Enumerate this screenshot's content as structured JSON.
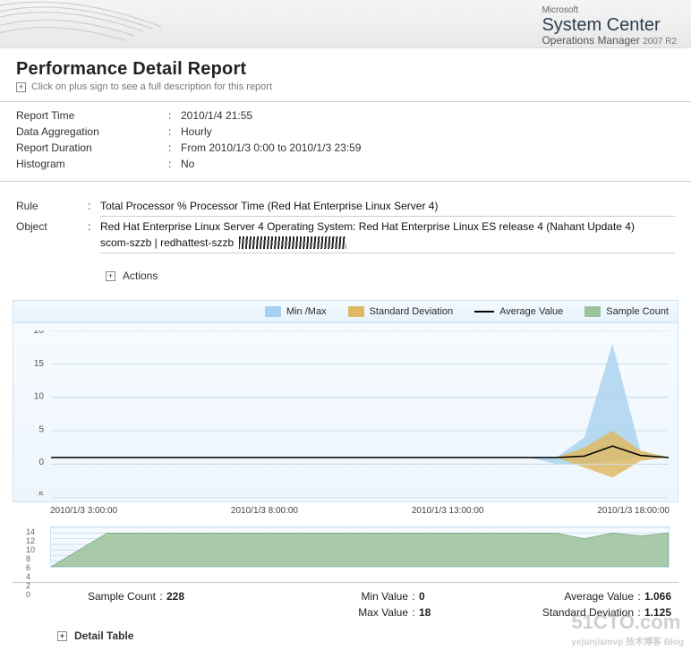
{
  "brand": {
    "ms": "Microsoft",
    "title": "System Center",
    "sub": "Operations Manager",
    "ver": "2007 R2"
  },
  "report": {
    "title": "Performance Detail Report",
    "hint": "Click on plus sign to see a full description for this report"
  },
  "meta": {
    "report_time_label": "Report Time",
    "report_time_value": "2010/1/4 21:55",
    "data_agg_label": "Data Aggregation",
    "data_agg_value": "Hourly",
    "duration_label": "Report Duration",
    "duration_value": "From  2010/1/3 0:00  to  2010/1/3 23:59",
    "histogram_label": "Histogram",
    "histogram_value": "No"
  },
  "rule": {
    "rule_label": "Rule",
    "rule_value": "Total Processor % Processor Time (Red Hat Enterprise Linux Server 4)",
    "object_label": "Object",
    "object_value_line1": "Red Hat Enterprise Linux Server 4 Operating System: Red Hat Enterprise Linux ES release 4 (Nahant Update 4)",
    "object_value_line2": "scom-szzb | redhattest-szzb"
  },
  "actions": {
    "label": "Actions"
  },
  "legend": {
    "minmax": "Min /Max",
    "std": "Standard Deviation",
    "avg": "Average Value",
    "count": "Sample Count"
  },
  "summary": {
    "sample_count_label": "Sample Count",
    "sample_count_value": "228",
    "min_label": "Min Value",
    "min_value": "0",
    "max_label": "Max Value",
    "max_value": "18",
    "avg_label": "Average Value",
    "avg_value": "1.066",
    "std_label": "Standard Deviation",
    "std_value": "1.125"
  },
  "detail": {
    "label": "Detail Table"
  },
  "watermark": {
    "main": "51CTO.com",
    "sub": "yejunjiamvp 技术博客 Blog"
  },
  "chart_data": {
    "main": {
      "type": "area",
      "ylabel": "",
      "ylim": [
        -5,
        20
      ],
      "yticks": [
        -5,
        0,
        5,
        10,
        15,
        20
      ],
      "x_categories": [
        "2010/1/3 3:00:00",
        "2010/1/3 8:00:00",
        "2010/1/3 13:00:00",
        "2010/1/3 18:00:00"
      ],
      "series": [
        {
          "name": "Min/Max",
          "type": "range",
          "min": [
            1,
            1,
            1,
            1,
            1,
            1,
            1,
            1,
            1,
            1,
            1,
            1,
            1,
            1,
            1,
            1,
            1,
            1,
            0,
            0,
            0.5,
            1,
            1
          ],
          "max": [
            1,
            1,
            1,
            1,
            1,
            1,
            1,
            1,
            1,
            1,
            1,
            1,
            1,
            1,
            1,
            1,
            1,
            1,
            1,
            4,
            18,
            2,
            1
          ],
          "color": "#a8d1ef"
        },
        {
          "name": "StdDev",
          "type": "range",
          "min": [
            1,
            1,
            1,
            1,
            1,
            1,
            1,
            1,
            1,
            1,
            1,
            1,
            1,
            1,
            1,
            1,
            1,
            1,
            1,
            -0.5,
            -2,
            0.5,
            1
          ],
          "max": [
            1,
            1,
            1,
            1,
            1,
            1,
            1,
            1,
            1,
            1,
            1,
            1,
            1,
            1,
            1,
            1,
            1,
            1,
            1,
            2.5,
            5,
            2,
            1
          ],
          "color": "#dfb865"
        },
        {
          "name": "Average",
          "type": "line",
          "values": [
            1,
            1,
            1,
            1,
            1,
            1,
            1,
            1,
            1,
            1,
            1,
            1,
            1,
            1,
            1,
            1,
            1,
            1,
            1,
            1.2,
            2.7,
            1.3,
            1
          ],
          "color": "#000"
        }
      ]
    },
    "mini": {
      "type": "area",
      "ylim": [
        0,
        14
      ],
      "yticks": [
        0,
        2,
        4,
        6,
        8,
        10,
        12,
        14
      ],
      "series": [
        {
          "name": "Sample Count",
          "values": [
            0,
            6,
            12,
            12,
            12,
            12,
            12,
            12,
            12,
            12,
            12,
            12,
            12,
            12,
            12,
            12,
            12,
            12,
            12,
            10,
            12,
            11,
            12
          ],
          "color": "#9bc29a"
        }
      ]
    }
  }
}
